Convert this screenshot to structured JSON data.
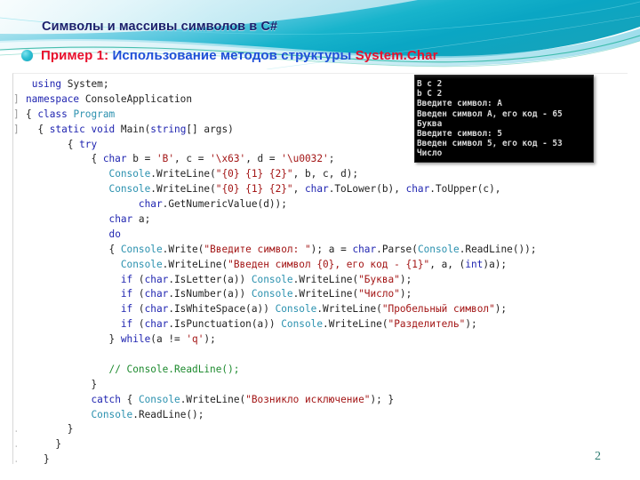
{
  "slide": {
    "title": "Символы  и массивы символов в C#",
    "page_number": "2",
    "accent_teal": "#17a9bd",
    "accent_dark_blue": "#1b1f6b",
    "accent_red": "#e8112d",
    "accent_blue": "#1f4fd8",
    "page_number_color": "#2a7a6f"
  },
  "subtitle": {
    "label_prefix": "Пример 1:",
    "label_middle": " Использование методов структуры ",
    "label_suffix": "System.Char",
    "bullet_icon": "bullet-circle-icon"
  },
  "code": {
    "language": "csharp",
    "lines": [
      {
        "gutter": "",
        "text": " using System;"
      },
      {
        "gutter": "]",
        "text": "namespace ConsoleApplication"
      },
      {
        "gutter": "]",
        "text": "{ class Program"
      },
      {
        "gutter": "]",
        "text": "  { static void Main(string[] args)"
      },
      {
        "gutter": "",
        "text": "       { try"
      },
      {
        "gutter": "",
        "text": "           { char b = 'B', c = '\\x63', d = '\\u0032';"
      },
      {
        "gutter": "",
        "text": "              Console.WriteLine(\"{0} {1} {2}\", b, c, d);"
      },
      {
        "gutter": "",
        "text": "              Console.WriteLine(\"{0} {1} {2}\", char.ToLower(b), char.ToUpper(c),"
      },
      {
        "gutter": "",
        "text": "                   char.GetNumericValue(d));"
      },
      {
        "gutter": "",
        "text": "              char a;"
      },
      {
        "gutter": "",
        "text": "              do"
      },
      {
        "gutter": "",
        "text": "              { Console.Write(\"Введите символ: \"); a = char.Parse(Console.ReadLine());"
      },
      {
        "gutter": "",
        "text": "                Console.WriteLine(\"Введен символ {0}, его код - {1}\", a, (int)a);"
      },
      {
        "gutter": "",
        "text": "                if (char.IsLetter(a)) Console.WriteLine(\"Буква\");"
      },
      {
        "gutter": "",
        "text": "                if (char.IsNumber(a)) Console.WriteLine(\"Число\");"
      },
      {
        "gutter": "",
        "text": "                if (char.IsWhiteSpace(a)) Console.WriteLine(\"Пробельный символ\");"
      },
      {
        "gutter": "",
        "text": "                if (char.IsPunctuation(a)) Console.WriteLine(\"Разделитель\");"
      },
      {
        "gutter": "",
        "text": "              } while(a != 'q');"
      },
      {
        "gutter": "",
        "text": ""
      },
      {
        "gutter": "",
        "text": "              // Console.ReadLine();"
      },
      {
        "gutter": "",
        "text": "           }"
      },
      {
        "gutter": "",
        "text": "           catch { Console.WriteLine(\"Возникло исключение\"); }"
      },
      {
        "gutter": "",
        "text": "           Console.ReadLine();"
      },
      {
        "gutter": ".",
        "text": "       }"
      },
      {
        "gutter": ".",
        "text": "     }"
      },
      {
        "gutter": ".",
        "text": "   }"
      }
    ]
  },
  "console": {
    "window_name": "console-output-window",
    "lines": [
      "B c 2",
      "b C 2",
      "Введите символ: A",
      "Введен символ A, его код - 65",
      "Буква",
      "Введите символ: 5",
      "Введен символ 5, его код - 53",
      "Число"
    ]
  }
}
